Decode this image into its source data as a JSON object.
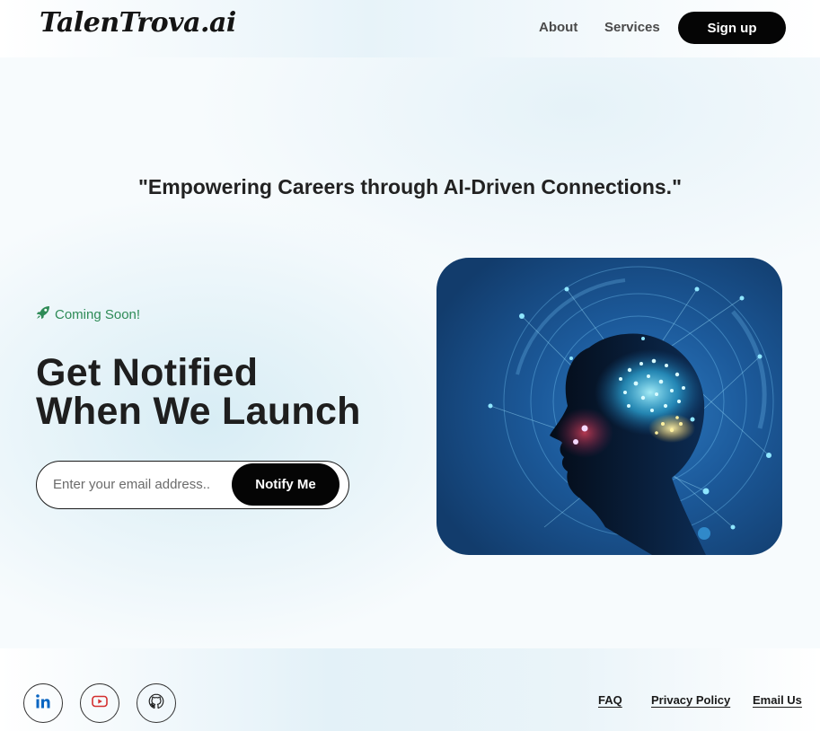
{
  "header": {
    "logo": "TalenTrova.ai",
    "nav": [
      {
        "label": "About"
      },
      {
        "label": "Services"
      }
    ],
    "signup_label": "Sign up"
  },
  "tagline": "\"Empowering Careers through AI-Driven Connections.\"",
  "hero": {
    "badge_icon": "rocket-icon",
    "badge": "Coming Soon!",
    "headline_line1": "Get Notified",
    "headline_line2": "When We Launch",
    "email_placeholder": "Enter your email address..",
    "email_value": "",
    "notify_label": "Notify Me",
    "image": "ai-brain-head-illustration"
  },
  "footer": {
    "social": [
      {
        "icon": "linkedin-icon",
        "color": "#0a66c2"
      },
      {
        "icon": "youtube-icon",
        "color": "#d32f2f"
      },
      {
        "icon": "github-icon",
        "color": "#222222"
      }
    ],
    "links": [
      {
        "label": "FAQ"
      },
      {
        "label": "Privacy Policy"
      },
      {
        "label": "Email Us"
      }
    ]
  },
  "colors": {
    "accent": "#050505",
    "badge": "#2e8b57"
  }
}
